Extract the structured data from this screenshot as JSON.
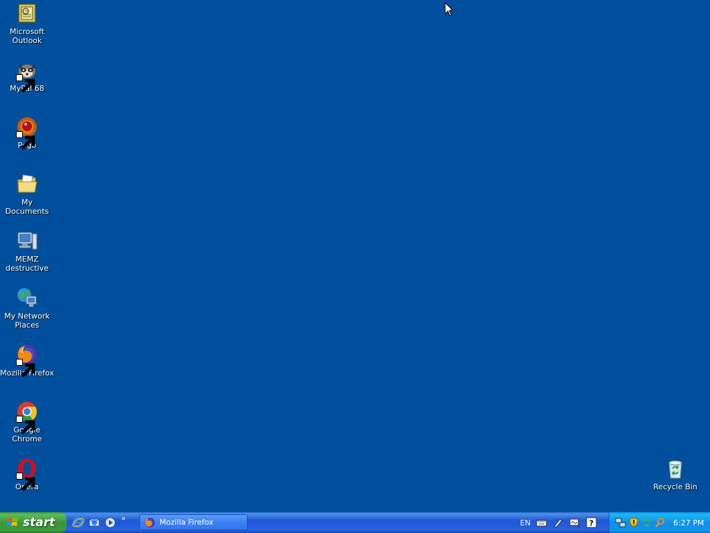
{
  "desktop": {
    "background_color": "#004f9c",
    "icons": [
      {
        "label": "Microsoft Outlook",
        "icon": "outlook-icon"
      },
      {
        "label": "MyPal 68",
        "icon": "mypal-icon",
        "shortcut": true
      },
      {
        "label": "Pego",
        "icon": "pego-icon",
        "shortcut": true
      },
      {
        "label": "My Documents",
        "icon": "folder-documents-icon"
      },
      {
        "label": "MEMZ destructive",
        "icon": "computer-icon"
      },
      {
        "label": "My Network Places",
        "icon": "network-places-icon"
      },
      {
        "label": "Mozilla Firefox",
        "icon": "firefox-icon",
        "shortcut": true
      },
      {
        "label": "Google Chrome",
        "icon": "chrome-icon",
        "shortcut": true
      },
      {
        "label": "Opera",
        "icon": "opera-icon",
        "shortcut": true
      },
      {
        "label": "Recycle Bin",
        "icon": "recycle-bin-icon"
      }
    ]
  },
  "taskbar": {
    "start_label": "start",
    "quick_launch": [
      "internet-explorer-icon",
      "outlook-express-icon",
      "media-player-icon"
    ],
    "overflow": "»",
    "tasks": [
      {
        "label": "Mozilla Firefox",
        "icon": "firefox-icon"
      }
    ],
    "language": "EN",
    "lang_icons": [
      "keyboard-icon",
      "pen-icon",
      "handwriting-icon",
      "help-icon"
    ],
    "tray_icons": [
      "network-icon",
      "security-shield-icon",
      "recycle-tray-icon",
      "search-tray-icon"
    ],
    "clock": "6:27 PM"
  }
}
